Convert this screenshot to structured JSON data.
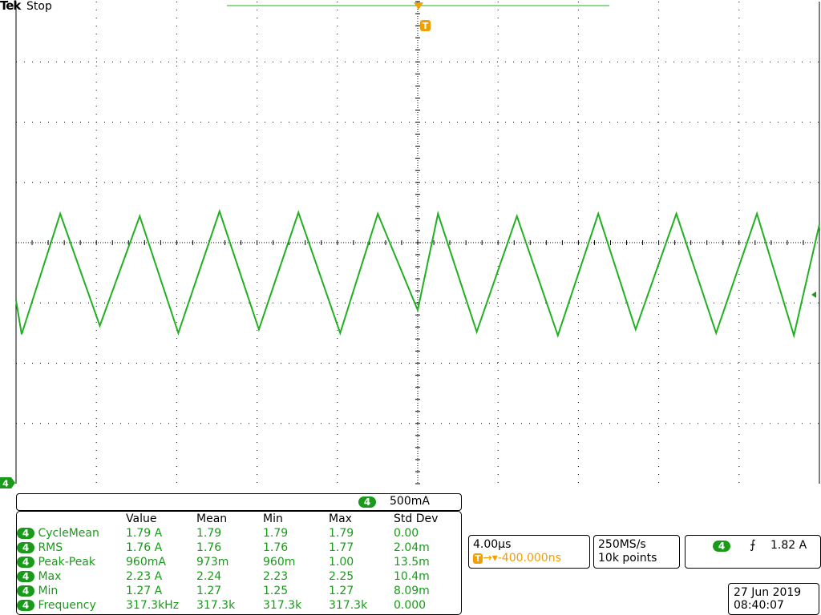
{
  "header": {
    "brand": "Tek",
    "status": "Stop"
  },
  "colors": {
    "trace": "#22b022",
    "channel_badge": "#1a9a1a",
    "trigger": "#f0a000",
    "grid": "#000000"
  },
  "channel": {
    "number": "4",
    "scale": "500mA"
  },
  "measurements": {
    "headers": [
      "",
      "Value",
      "Mean",
      "Min",
      "Max",
      "Std Dev"
    ],
    "rows": [
      {
        "ch": "4",
        "name": "CycleMean",
        "value": "1.79 A",
        "mean": "1.79",
        "min": "1.79",
        "max": "1.79",
        "std": "0.00"
      },
      {
        "ch": "4",
        "name": "RMS",
        "value": "1.76 A",
        "mean": "1.76",
        "min": "1.76",
        "max": "1.77",
        "std": "2.04m"
      },
      {
        "ch": "4",
        "name": "Peak-Peak",
        "value": "960mA",
        "mean": "973m",
        "min": "960m",
        "max": "1.00",
        "std": "13.5m"
      },
      {
        "ch": "4",
        "name": "Max",
        "value": "2.23 A",
        "mean": "2.24",
        "min": "2.23",
        "max": "2.25",
        "std": "10.4m"
      },
      {
        "ch": "4",
        "name": "Min",
        "value": "1.27 A",
        "mean": "1.27",
        "min": "1.25",
        "max": "1.27",
        "std": "8.09m"
      },
      {
        "ch": "4",
        "name": "Frequency",
        "value": "317.3kHz",
        "mean": "317.3k",
        "min": "317.3k",
        "max": "317.3k",
        "std": "0.000"
      }
    ]
  },
  "timebase": {
    "scale": "4.00µs",
    "trigger_offset": "→▾-400.000ns",
    "trigger_badge": "T"
  },
  "acquisition": {
    "sample_rate": "250MS/s",
    "record_length": "10k points"
  },
  "trigger": {
    "channel": "4",
    "slope_symbol": "⨍",
    "level": "1.82 A"
  },
  "timestamp": {
    "date": "27 Jun 2019",
    "time": "08:40:07"
  },
  "markers": {
    "ground_label": "4",
    "trigger_top_label": "T"
  },
  "chart_data": {
    "type": "line",
    "title": "",
    "xlabel": "",
    "ylabel": "",
    "waveform": "triangle",
    "time_per_div_us": 4.0,
    "amps_per_div": 0.5,
    "divisions": {
      "x": 10,
      "y": 8
    },
    "series": [
      {
        "x_us": [
          -20.0,
          -19.72,
          -17.8,
          -15.83,
          -13.84,
          -11.92,
          -9.87,
          -7.91,
          -5.94,
          -3.86,
          -1.99,
          0.0,
          1.01,
          2.94,
          4.94,
          6.98,
          8.99,
          10.85,
          12.88,
          14.86,
          16.89,
          18.73,
          20.0
        ],
        "y_A": [
          1.52,
          1.24,
          2.24,
          1.31,
          2.22,
          1.25,
          2.26,
          1.28,
          2.25,
          1.25,
          2.24,
          1.44,
          2.24,
          1.26,
          2.22,
          1.23,
          2.24,
          1.28,
          2.24,
          1.25,
          2.24,
          1.23,
          2.15
        ]
      }
    ]
  }
}
